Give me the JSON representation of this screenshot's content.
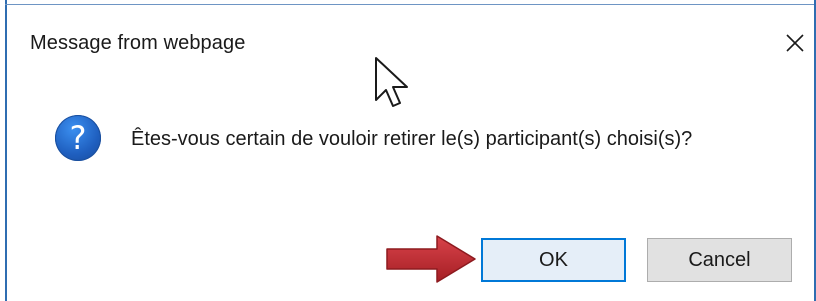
{
  "dialog": {
    "title": "Message from webpage",
    "message": "Êtes-vous certain de vouloir retirer le(s) participant(s) choisi(s)?",
    "icon": "question-icon",
    "close_icon": "close-icon",
    "buttons": {
      "ok_label": "OK",
      "cancel_label": "Cancel"
    }
  },
  "annotation": {
    "arrow_color": "#c0262b",
    "points_to": "ok-button"
  },
  "colors": {
    "frame": "#2f6db1",
    "ok_border": "#0078d7",
    "icon_blue": "#1f5fbf"
  }
}
